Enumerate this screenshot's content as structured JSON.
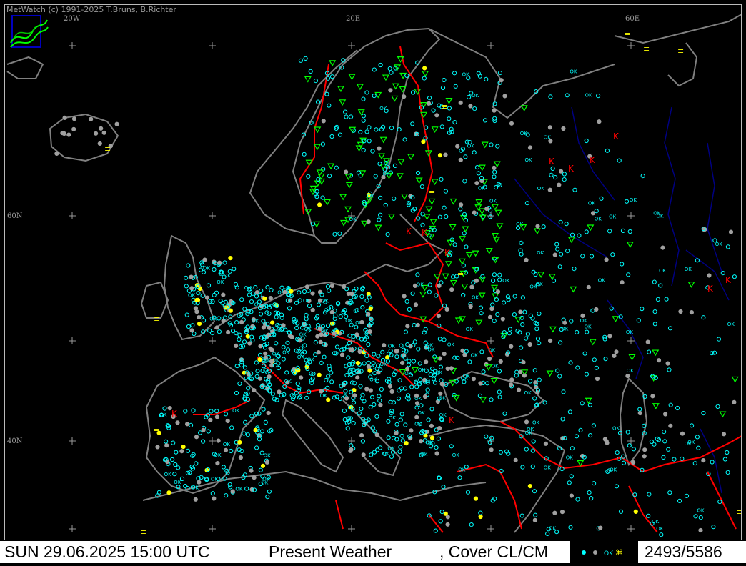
{
  "app": {
    "copyright": "MetWatch  (c) 1991-2025 T.Bruns, B.Richter",
    "logo_icon": "metwatch-logo-icon"
  },
  "map": {
    "longitude_labels": [
      "20W",
      "20E",
      "60E"
    ],
    "latitude_labels": [
      "60N",
      "40N"
    ],
    "colors": {
      "background": "#000000",
      "coastline": "#808080",
      "borders": "#ff0000",
      "rivers": "#000080",
      "clear_obs": "#00ffff",
      "missing_obs": "#a0a0a0",
      "rain": "#00ff00",
      "thunder": "#ff0000",
      "fog_haze": "#ffff00"
    },
    "ok_label": "OK"
  },
  "status": {
    "datetime": "SUN 29.06.2025 15:00 UTC",
    "product": "Present Weather",
    "overlay": ", Cover CL/CM",
    "count": "2493/5586"
  }
}
